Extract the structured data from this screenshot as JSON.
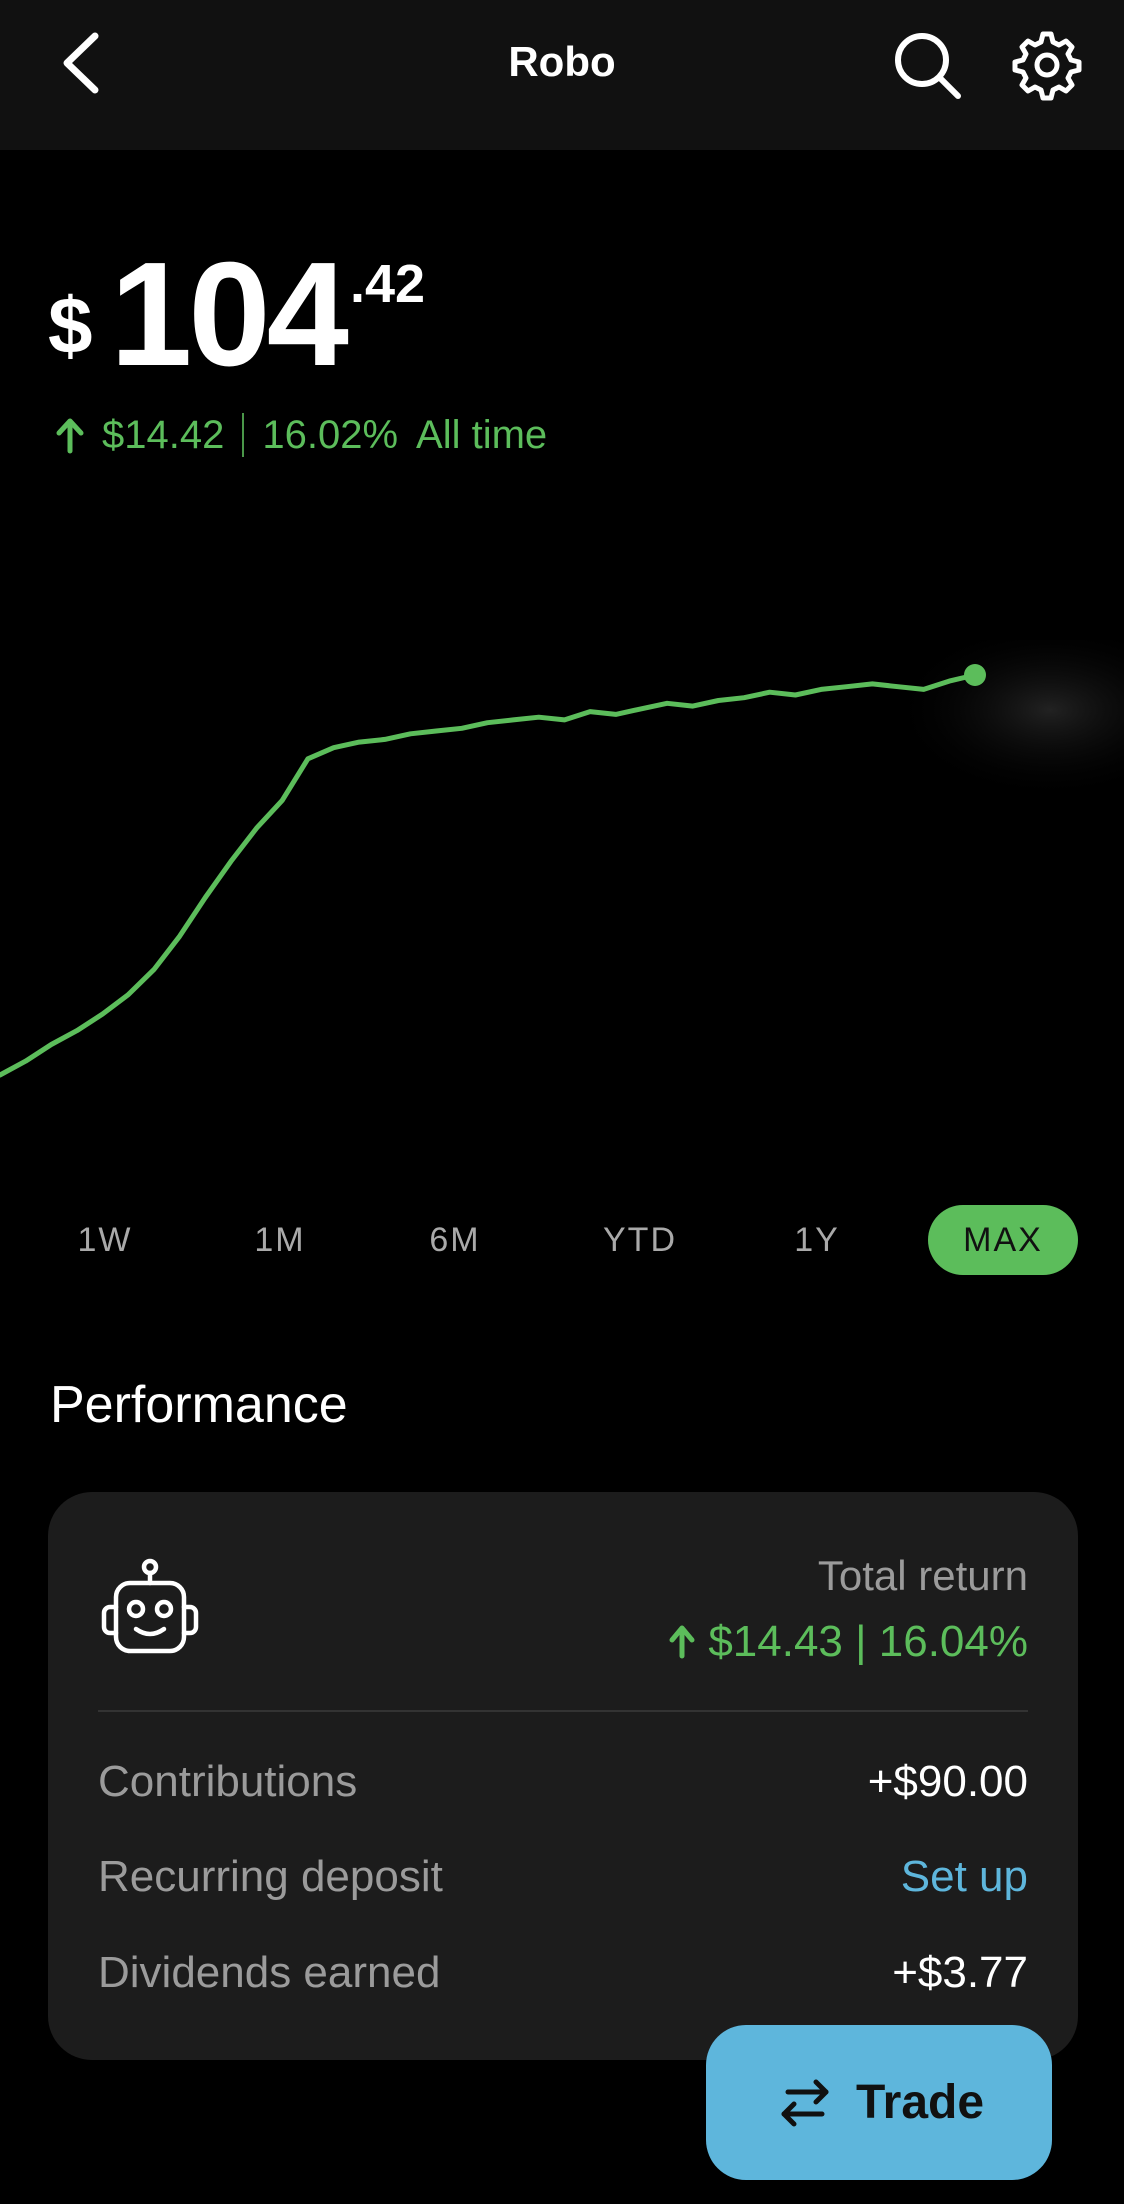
{
  "header": {
    "title": "Robo",
    "back_icon": "chevron-left-icon",
    "search_icon": "search-icon",
    "settings_icon": "gear-icon"
  },
  "balance": {
    "currency": "$",
    "integer": "104",
    "cents": ".42"
  },
  "change": {
    "amount": "$14.42",
    "percent": "16.02%",
    "period": "All time",
    "direction_icon": "arrow-up-icon"
  },
  "chart_data": {
    "type": "line",
    "series": [
      {
        "values": [
          90.0,
          90.5,
          91.1,
          91.6,
          92.2,
          92.9,
          93.8,
          95.0,
          96.4,
          97.7,
          98.9,
          99.9,
          101.4,
          101.8,
          102.0,
          102.1,
          102.3,
          102.4,
          102.5,
          102.7,
          102.8,
          102.9,
          102.8,
          103.1,
          103.0,
          103.2,
          103.4,
          103.3,
          103.5,
          103.6,
          103.8,
          103.7,
          103.9,
          104.0,
          104.1,
          104.0,
          103.9,
          104.2,
          104.42
        ]
      }
    ],
    "colors": {
      "line": "#5cbd5b",
      "background": "#000000"
    }
  },
  "ranges": {
    "items": [
      "1W",
      "1M",
      "6M",
      "YTD",
      "1Y",
      "MAX"
    ],
    "selected": "MAX",
    "accent": "#5cbd5b"
  },
  "performance": {
    "title": "Performance",
    "robot_icon": "robot-icon",
    "total_return_label": "Total return",
    "total_return_value": "$14.43 | 16.04%",
    "rows": [
      {
        "label": "Contributions",
        "value": "+$90.00"
      },
      {
        "label": "Recurring deposit",
        "value": "Set up"
      },
      {
        "label": "Dividends earned",
        "value": "+$3.77"
      }
    ]
  },
  "trade": {
    "label": "Trade",
    "icon": "swap-arrows-icon",
    "color": "#5eb6dc"
  }
}
